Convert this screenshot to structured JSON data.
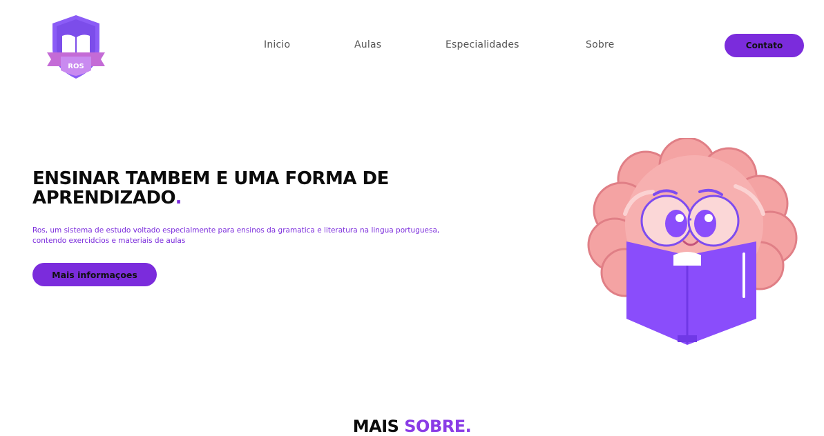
{
  "brand": {
    "logo_text": "ROS"
  },
  "nav": {
    "items": [
      {
        "label": "Inicio"
      },
      {
        "label": "Aulas"
      },
      {
        "label": "Especialidades"
      },
      {
        "label": "Sobre"
      }
    ],
    "contact_label": "Contato"
  },
  "hero": {
    "title": "ENSINAR TAMBEM E UMA FORMA DE APRENDIZADO",
    "title_dot": ".",
    "description": "Ros, um sistema de estudo voltado especialmente para ensinos da gramatica e literatura na lingua portuguesa, contendo exercidcios e materiais de aulas",
    "button_label": "Mais informaçoes"
  },
  "section": {
    "title_part1": "MAIS ",
    "title_part2": "SOBRE."
  },
  "colors": {
    "accent": "#7b2cdc",
    "brain": "#f4a3a3",
    "book": "#8a4dfb"
  }
}
